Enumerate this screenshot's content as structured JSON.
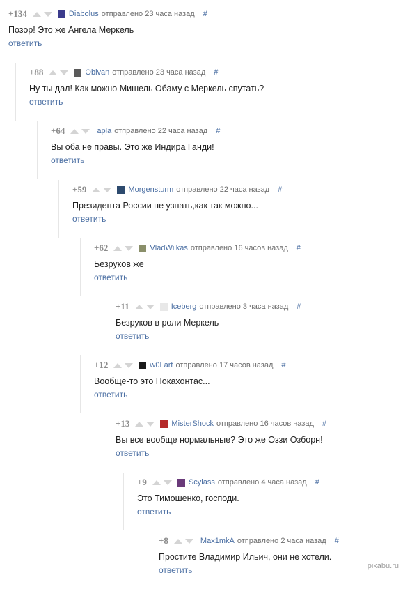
{
  "sent_label": "отправлено",
  "reply_label": "ответить",
  "hash_label": "#",
  "watermark": "pikabu.ru",
  "comments": [
    {
      "rating": "+134",
      "user": "Diabolus",
      "time": "23 часа назад",
      "text": "Позор! Это же Ангела Меркель",
      "avatar_color": "#3b3b8c"
    },
    {
      "rating": "+88",
      "user": "Obivan",
      "time": "23 часа назад",
      "text": "Ну ты дал! Как можно Мишель Обаму с Меркель спутать?",
      "avatar_color": "#5a5a5a"
    },
    {
      "rating": "+64",
      "user": "apla",
      "time": "22 часа назад",
      "text": "Вы оба не правы. Это же Индира Ганди!",
      "avatar_color": ""
    },
    {
      "rating": "+59",
      "user": "Morgensturm",
      "time": "22 часа назад",
      "text": "Президента России не узнать,как так можно...",
      "avatar_color": "#2d4a6e"
    },
    {
      "rating": "+62",
      "user": "VladWilkas",
      "time": "16 часов назад",
      "text": "Безруков же",
      "avatar_color": "#8a8f6a"
    },
    {
      "rating": "+11",
      "user": "Iceberg",
      "time": "3 часа назад",
      "text": "Безруков в роли Меркель",
      "avatar_color": "#e8e8e8"
    },
    {
      "rating": "+12",
      "user": "w0Lart",
      "time": "17 часов назад",
      "text": "Вообще-то это Покахонтас...",
      "avatar_color": "#1a1a1a"
    },
    {
      "rating": "+13",
      "user": "MisterShock",
      "time": "16 часов назад",
      "text": "Вы все вообще нормальные? Это же Оззи Озборн!",
      "avatar_color": "#b52a2a"
    },
    {
      "rating": "+9",
      "user": "Scylass",
      "time": "4 часа назад",
      "text": "Это Тимошенко, господи.",
      "avatar_color": "#6a3a7a"
    },
    {
      "rating": "+8",
      "user": "Max1mkA",
      "time": "2 часа назад",
      "text": "Простите Владимир Ильич, они не хотели.",
      "avatar_color": ""
    }
  ]
}
